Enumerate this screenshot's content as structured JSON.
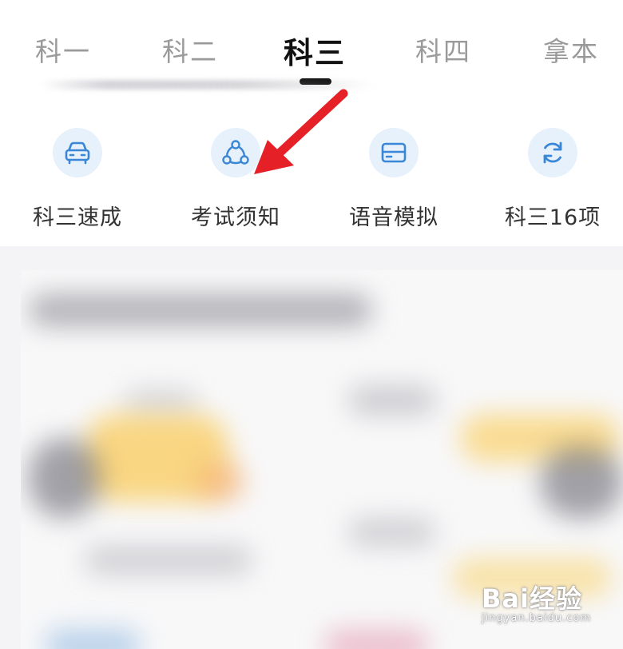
{
  "tabs": [
    {
      "label": "科一",
      "active": false
    },
    {
      "label": "科二",
      "active": false
    },
    {
      "label": "科三",
      "active": true
    },
    {
      "label": "科四",
      "active": false
    },
    {
      "label": "拿本",
      "active": false
    }
  ],
  "features": [
    {
      "label": "科三速成",
      "icon": "car-icon"
    },
    {
      "label": "考试须知",
      "icon": "share-nodes-icon"
    },
    {
      "label": "语音模拟",
      "icon": "card-icon"
    },
    {
      "label": "科三16项",
      "icon": "refresh-icon"
    }
  ],
  "watermark": {
    "main": "Bai经验",
    "sub": "jingyan.baidu.com"
  },
  "colors": {
    "accent": "#3a87d6",
    "icon_bg": "#e6f1fc",
    "arrow": "#e52027",
    "active_tab": "#111111",
    "inactive_tab": "#9a9a9a"
  }
}
